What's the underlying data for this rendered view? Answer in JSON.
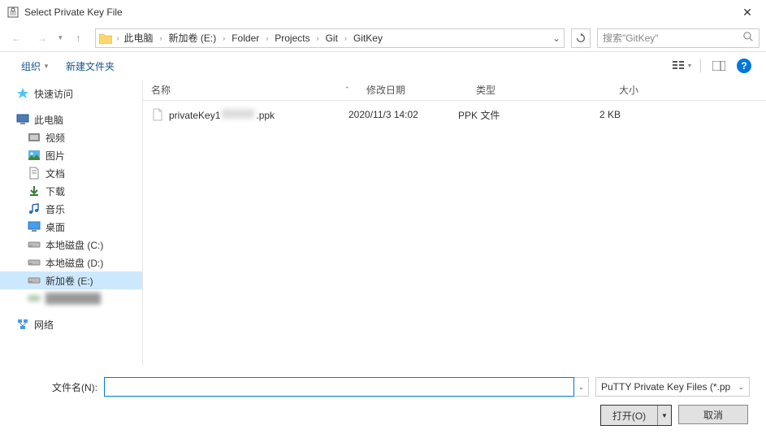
{
  "window": {
    "title": "Select Private Key File"
  },
  "breadcrumb": {
    "items": [
      "此电脑",
      "新加卷 (E:)",
      "Folder",
      "Projects",
      "Git",
      "GitKey"
    ]
  },
  "search": {
    "placeholder": "搜索\"GitKey\""
  },
  "toolbar": {
    "organize": "组织",
    "newfolder": "新建文件夹"
  },
  "sidebar": {
    "quickaccess": "快速访问",
    "thispc": "此电脑",
    "items": {
      "video": "视频",
      "pictures": "图片",
      "documents": "文档",
      "downloads": "下载",
      "music": "音乐",
      "desktop": "桌面",
      "diskC": "本地磁盘 (C:)",
      "diskD": "本地磁盘 (D:)",
      "diskE": "新加卷 (E:)"
    },
    "network": "网络"
  },
  "columns": {
    "name": "名称",
    "date": "修改日期",
    "type": "类型",
    "size": "大小"
  },
  "files": [
    {
      "name_prefix": "privateKey1",
      "name_suffix": ".ppk",
      "date": "2020/11/3 14:02",
      "type": "PPK 文件",
      "size": "2 KB"
    }
  ],
  "bottom": {
    "filename_label": "文件名(N):",
    "filetype": "PuTTY Private Key Files (*.pp",
    "open": "打开(O)",
    "cancel": "取消"
  }
}
